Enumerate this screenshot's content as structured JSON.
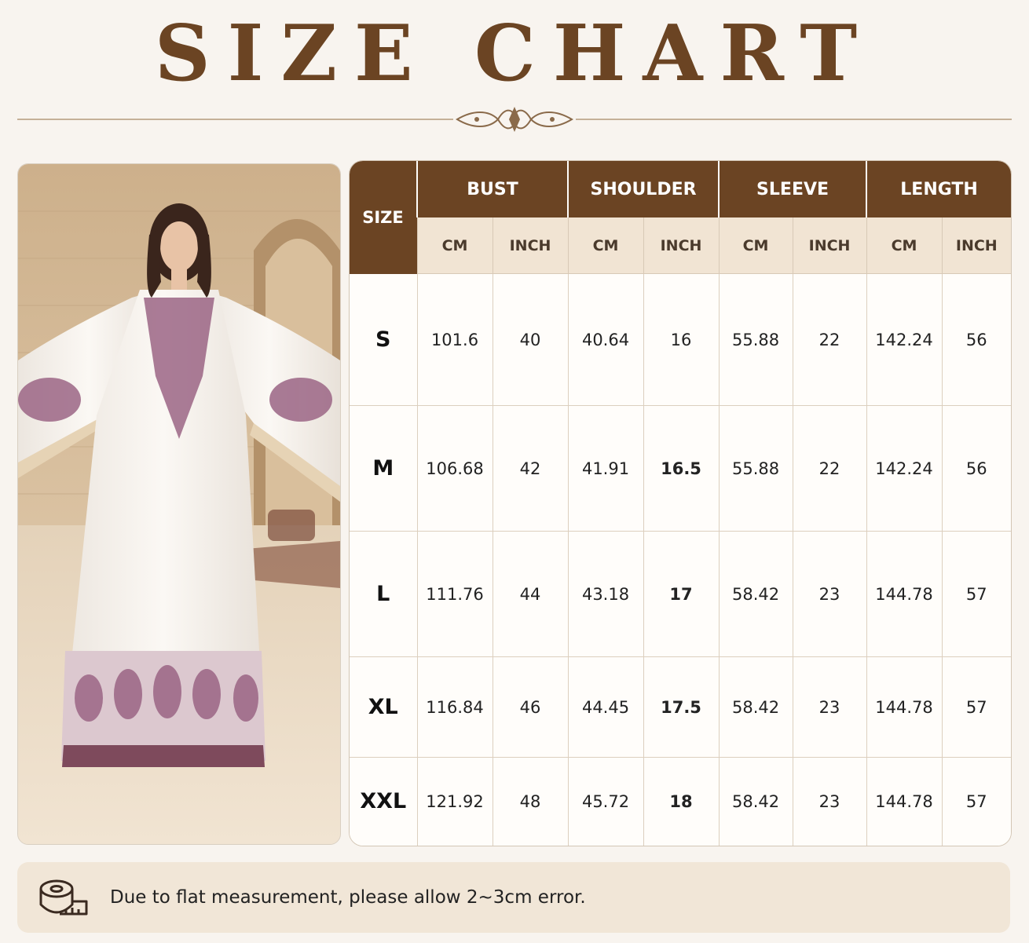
{
  "header": {
    "title": "SIZE CHART",
    "ornament_icon": "flourish-ornament-icon"
  },
  "colors": {
    "brand_brown": "#6b4423",
    "unit_row_bg": "#f1e4d3",
    "background": "#f8f4ef"
  },
  "photo": {
    "icon": "model-in-embroidered-kaftan-photo"
  },
  "table": {
    "size_header": "SIZE",
    "groups": [
      "BUST",
      "SHOULDER",
      "SLEEVE",
      "LENGTH"
    ],
    "units": [
      "CM",
      "INCH",
      "CM",
      "INCH",
      "CM",
      "INCH",
      "CM",
      "INCH"
    ],
    "rows": [
      {
        "size": "S",
        "values": [
          "101.6",
          "40",
          "40.64",
          "16",
          "55.88",
          "22",
          "142.24",
          "56"
        ]
      },
      {
        "size": "M",
        "values": [
          "106.68",
          "42",
          "41.91",
          "16.5",
          "55.88",
          "22",
          "142.24",
          "56"
        ]
      },
      {
        "size": "L",
        "values": [
          "111.76",
          "44",
          "43.18",
          "17",
          "58.42",
          "23",
          "144.78",
          "57"
        ]
      },
      {
        "size": "XL",
        "values": [
          "116.84",
          "46",
          "44.45",
          "17.5",
          "58.42",
          "23",
          "144.78",
          "57"
        ]
      },
      {
        "size": "XXL",
        "values": [
          "121.92",
          "48",
          "45.72",
          "18",
          "58.42",
          "23",
          "144.78",
          "57"
        ]
      }
    ]
  },
  "note": {
    "icon": "measuring-tape-icon",
    "text": "Due to flat measurement, please allow 2~3cm error."
  }
}
